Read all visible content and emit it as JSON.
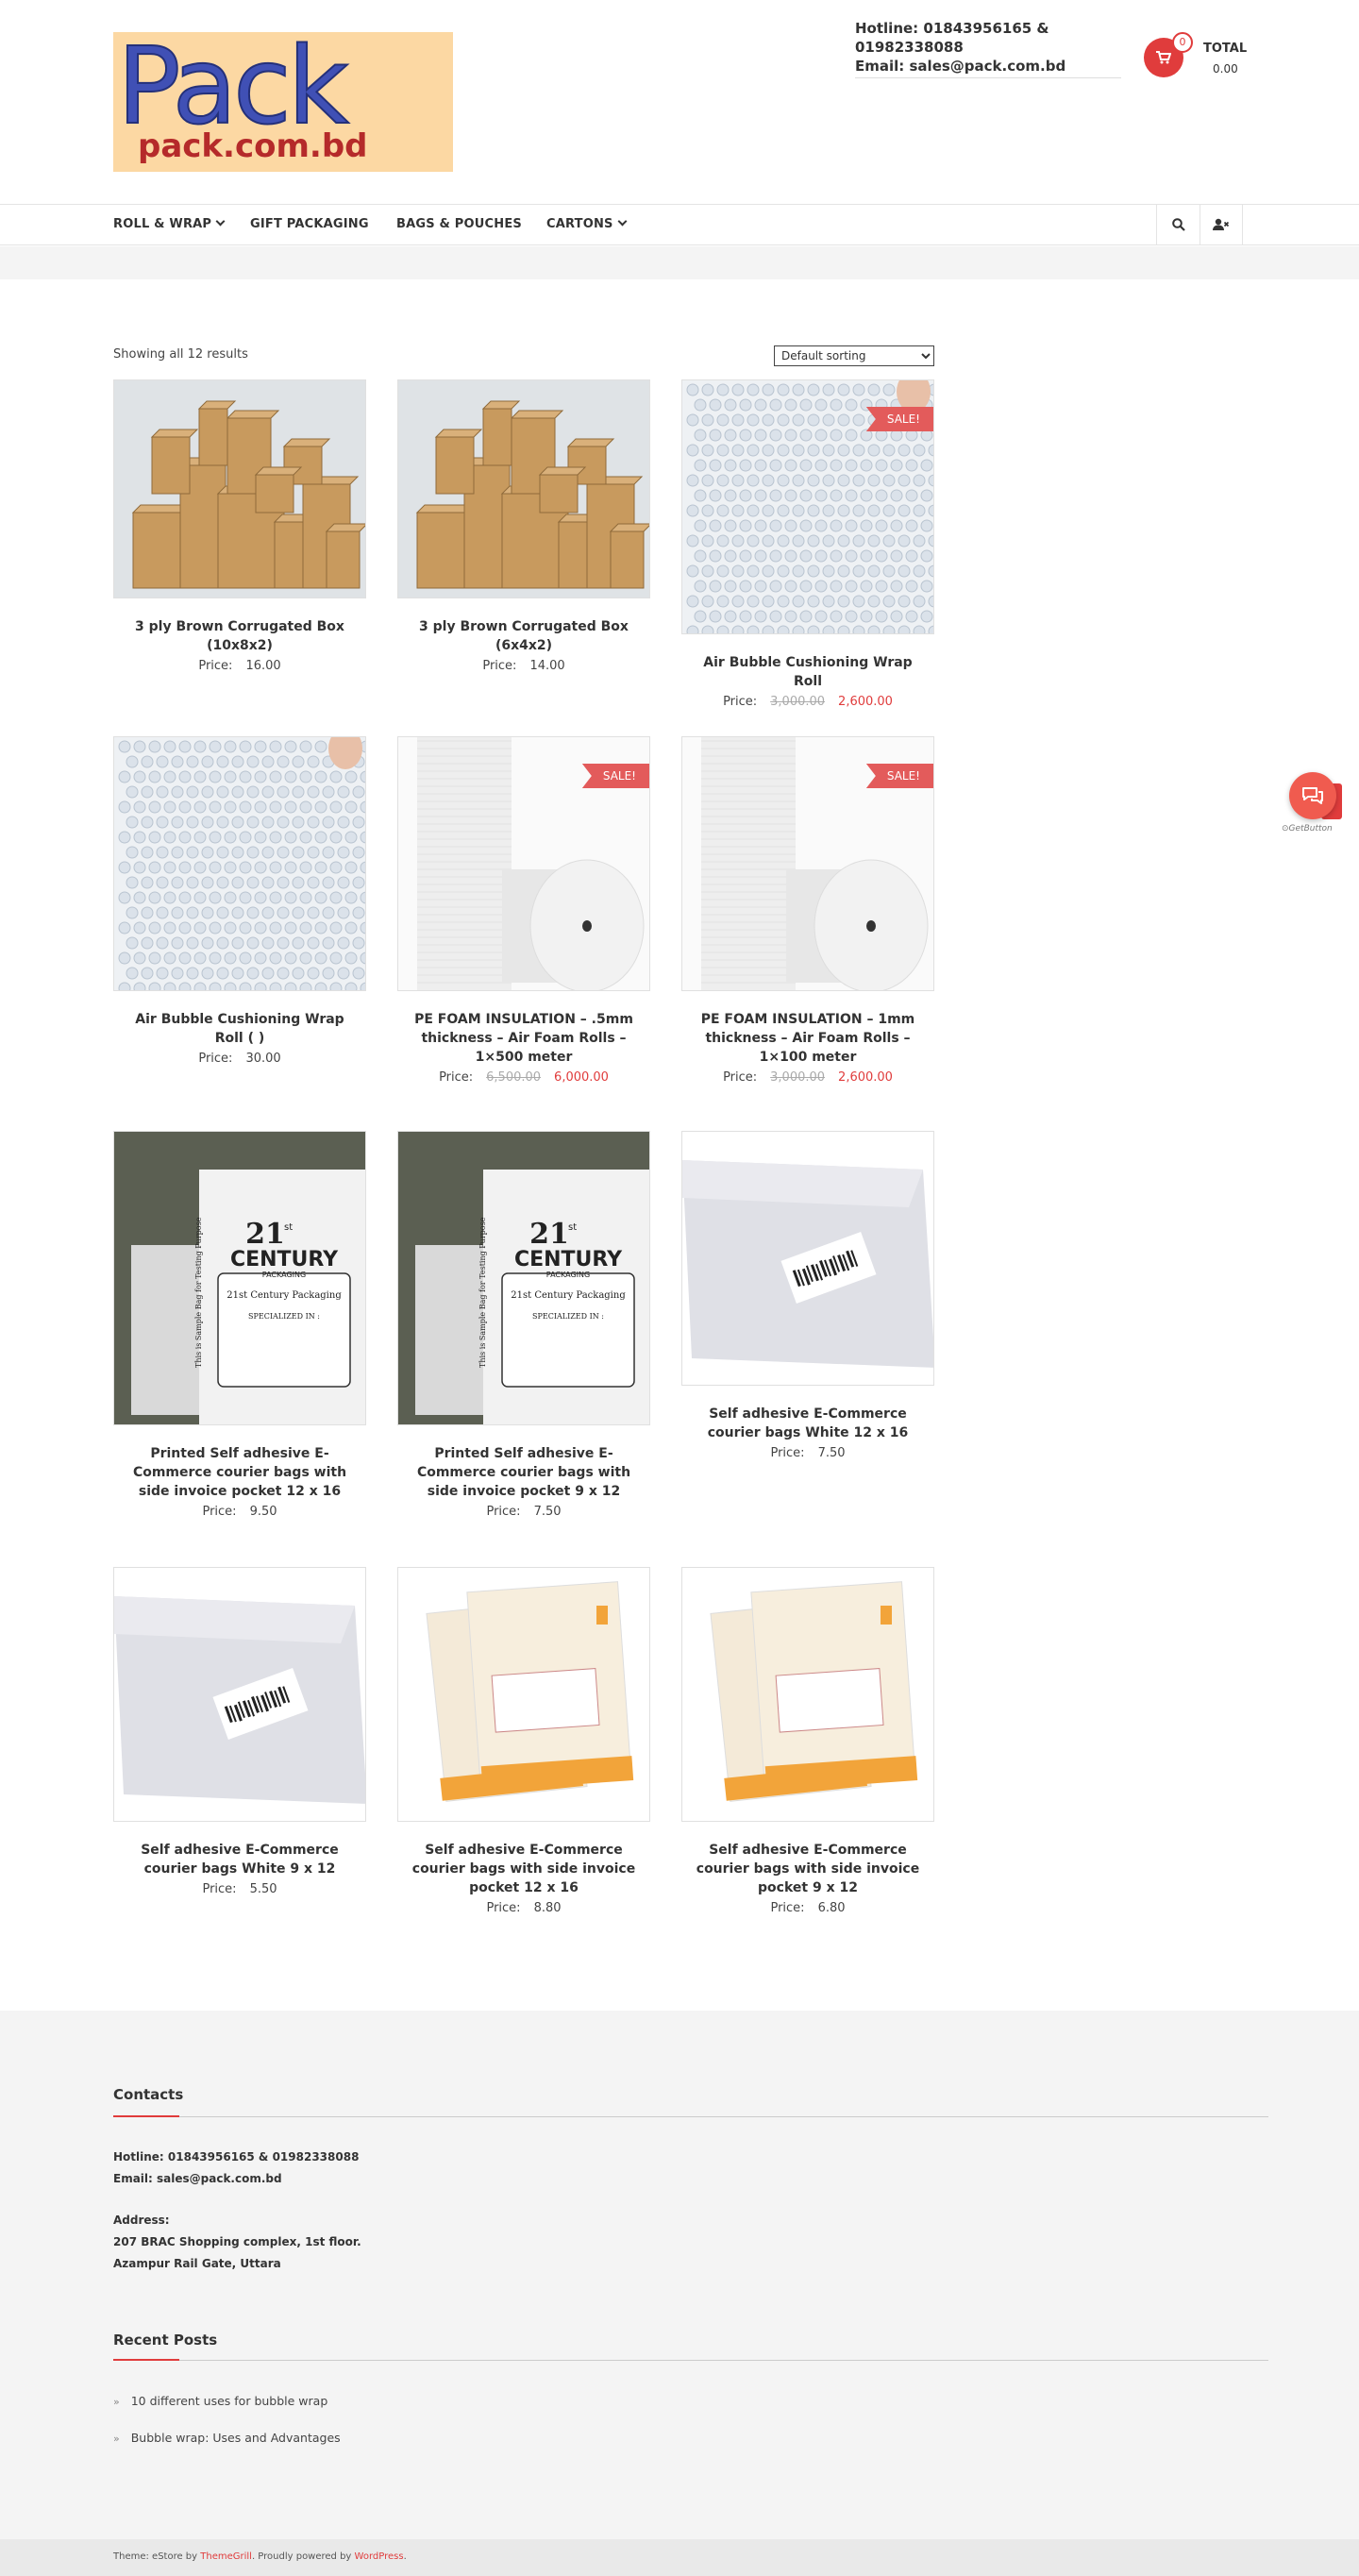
{
  "header": {
    "logo_text": "Pack",
    "logo_subtext": "pack.com.bd",
    "hotline": "Hotline: 01843956165 & 01982338088",
    "email": "Email: sales@pack.com.bd",
    "cart_count": "0",
    "cart_total_label": "TOTAL",
    "cart_total_value": "0.00"
  },
  "nav": {
    "items": [
      {
        "label": "ROLL & WRAP",
        "dropdown": true
      },
      {
        "label": "GIFT PACKAGING",
        "dropdown": false
      },
      {
        "label": "BAGS & POUCHES",
        "dropdown": false
      },
      {
        "label": "CARTONS",
        "dropdown": true
      }
    ],
    "icons": [
      "search-icon",
      "user-x-icon"
    ]
  },
  "shop": {
    "results_count": "Showing all 12 results",
    "sort_selected": "Default sorting",
    "price_label": "Price:",
    "sale_label": "SALE!",
    "products": [
      {
        "title": "3 ply Brown Corrugated Box (10x8x2)",
        "price": "16.00",
        "image": "boxes"
      },
      {
        "title": "3 ply Brown Corrugated Box (6x4x2)",
        "price": "14.00",
        "image": "boxes"
      },
      {
        "title": "Air Bubble Cushioning Wrap Roll",
        "old_price": "3,000.00",
        "price": "2,600.00",
        "sale": true,
        "image": "bubble"
      },
      {
        "title": "Air Bubble Cushioning Wrap Roll (                )",
        "price": "30.00",
        "image": "bubble"
      },
      {
        "title": "PE FOAM INSULATION – .5mm thickness – Air Foam Rolls – 1×500 meter",
        "old_price": "6,500.00",
        "price": "6,000.00",
        "sale": true,
        "image": "foam"
      },
      {
        "title": "PE FOAM INSULATION – 1mm thickness – Air Foam Rolls – 1×100 meter",
        "old_price": "3,000.00",
        "price": "2,600.00",
        "sale": true,
        "image": "foam"
      },
      {
        "title": "Printed Self adhesive E-Commerce courier bags with side invoice pocket 12 x 16",
        "price": "9.50",
        "image": "printed"
      },
      {
        "title": "Printed Self adhesive E-Commerce courier bags with side invoice pocket 9 x 12",
        "price": "7.50",
        "image": "printed"
      },
      {
        "title": "Self adhesive E-Commerce courier bags White 12 x 16",
        "price": "7.50",
        "image": "whitebag"
      },
      {
        "title": "Self adhesive E-Commerce courier bags White 9 x 12",
        "price": "5.50",
        "image": "whitebag"
      },
      {
        "title": "Self adhesive E-Commerce courier bags with side invoice pocket 12 x 16",
        "price": "8.80",
        "image": "invoicebag"
      },
      {
        "title": "Self adhesive E-Commerce courier bags with side invoice pocket 9 x 12",
        "price": "6.80",
        "image": "invoicebag"
      }
    ],
    "printed_bag_text": {
      "brand_line1": "21",
      "brand_sup": "st",
      "brand_line2": "CENTURY",
      "brand_line3": "PACKAGING",
      "sub": "21st Century Packaging",
      "spec": "SPECIALIZED IN :",
      "side": "This is Sample Bag for Testing Purpose"
    }
  },
  "floating": {
    "getbutton": "GetButton"
  },
  "footer": {
    "contacts_title": "Contacts",
    "hotline": "Hotline: 01843956165 & 01982338088",
    "email": "Email: sales@pack.com.bd",
    "address_label": "Address:",
    "address_line1": "207 BRAC Shopping complex, 1st floor.",
    "address_line2": "Azampur Rail Gate, Uttara",
    "recent_title": "Recent Posts",
    "posts": [
      "10 different uses for bubble wrap",
      "Bubble wrap: Uses and Advantages"
    ],
    "theme_prefix": "Theme: eStore by ",
    "theme_author": "ThemeGrill",
    "powered_prefix": ". Proudly powered by ",
    "powered_by": "WordPress",
    "powered_suffix": "."
  },
  "colors": {
    "accent": "#e03c3c",
    "sale": "#e35b5b",
    "logo_bg": "#fcd8a3",
    "logo_text": "#4050b5",
    "logo_subtext": "#b52a2a"
  }
}
